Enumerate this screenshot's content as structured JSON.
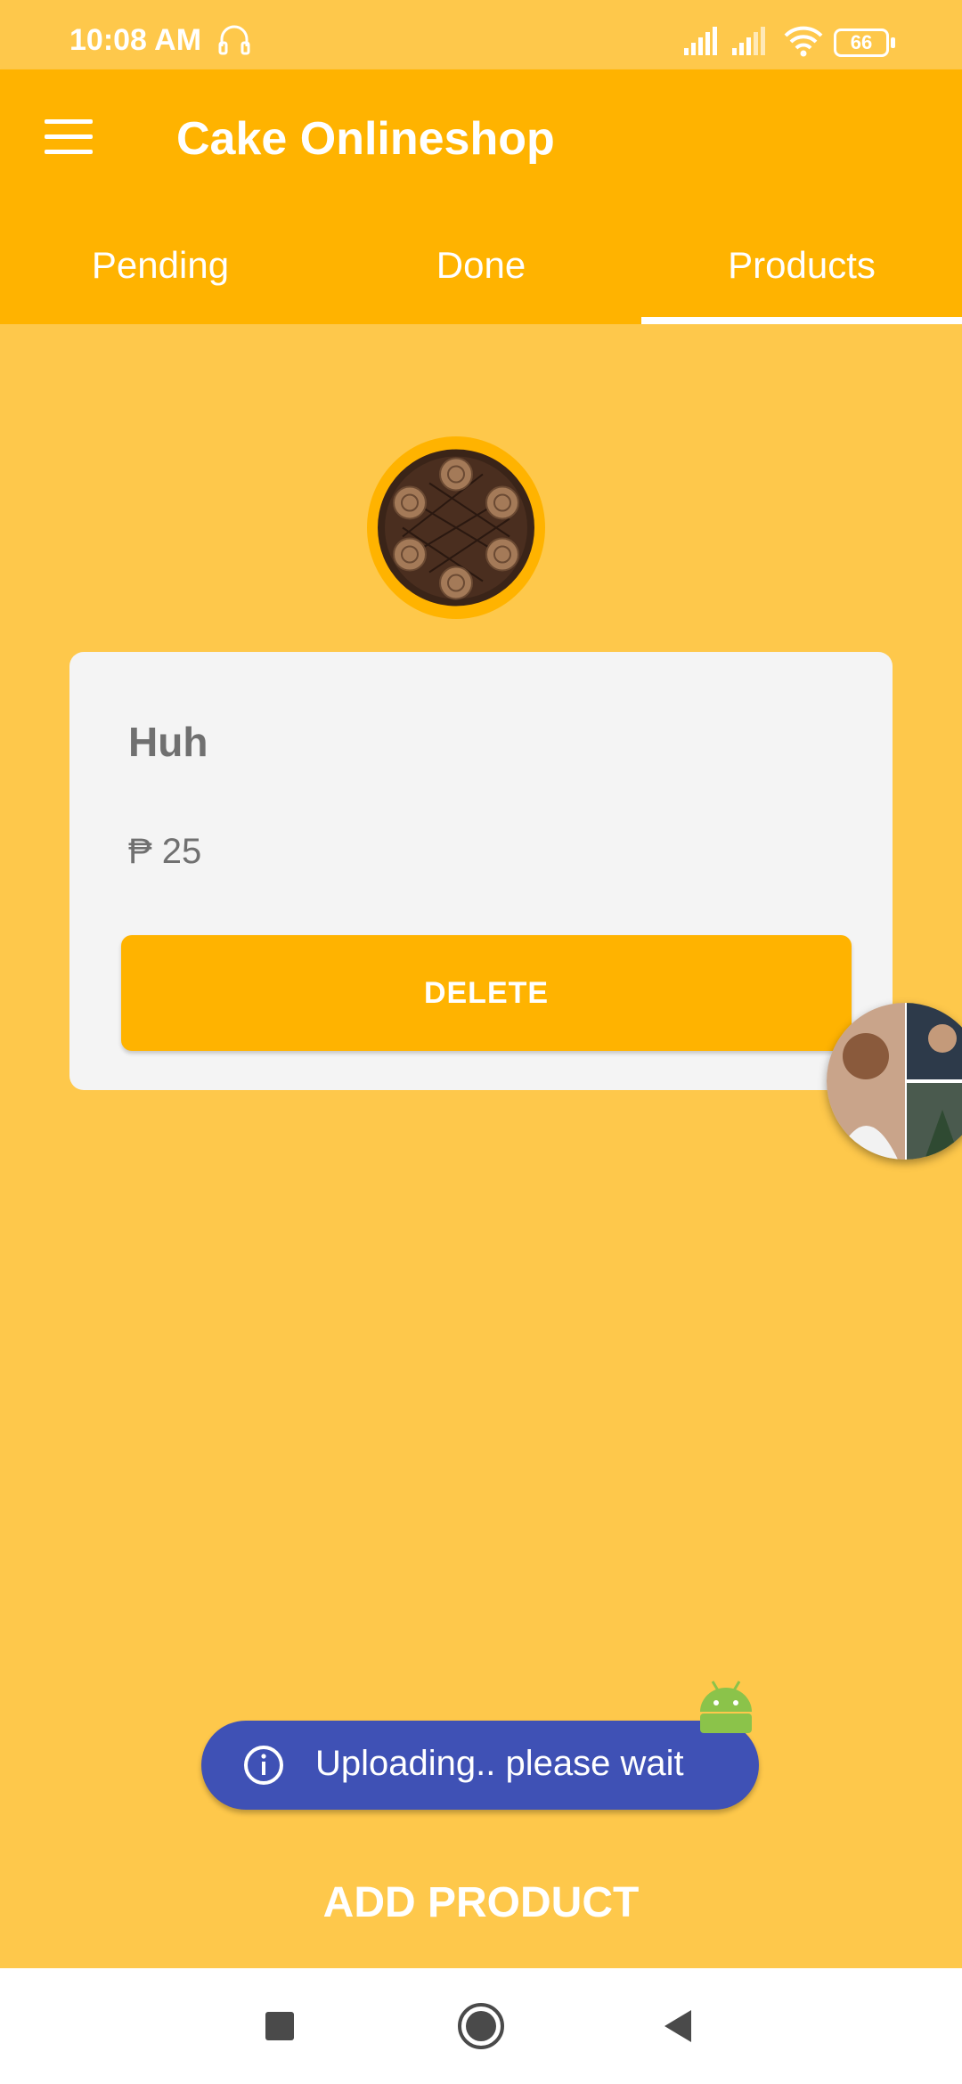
{
  "status_bar": {
    "time": "10:08 AM",
    "battery": "66",
    "icons": [
      "headset-icon",
      "signal-icon",
      "signal-icon",
      "wifi-icon",
      "battery-icon"
    ]
  },
  "app_bar": {
    "title": "Cake Onlineshop",
    "menu_icon": "hamburger-menu-icon"
  },
  "tabs": [
    {
      "label": "Pending",
      "selected": false
    },
    {
      "label": "Done",
      "selected": false
    },
    {
      "label": "Products",
      "selected": true
    }
  ],
  "product": {
    "name": "Huh",
    "price": "₱ 25",
    "delete_label": "DELETE"
  },
  "toast": {
    "message": "Uploading.. please wait"
  },
  "add_product_label": "ADD PRODUCT",
  "nav_bar": {
    "items": [
      "recents-icon",
      "home-icon",
      "back-icon"
    ]
  },
  "colors": {
    "background": "#FEC84B",
    "primary": "#FFB300",
    "card": "#F4F4F4",
    "toast": "#3F51B5",
    "text_gray": "#707070"
  }
}
